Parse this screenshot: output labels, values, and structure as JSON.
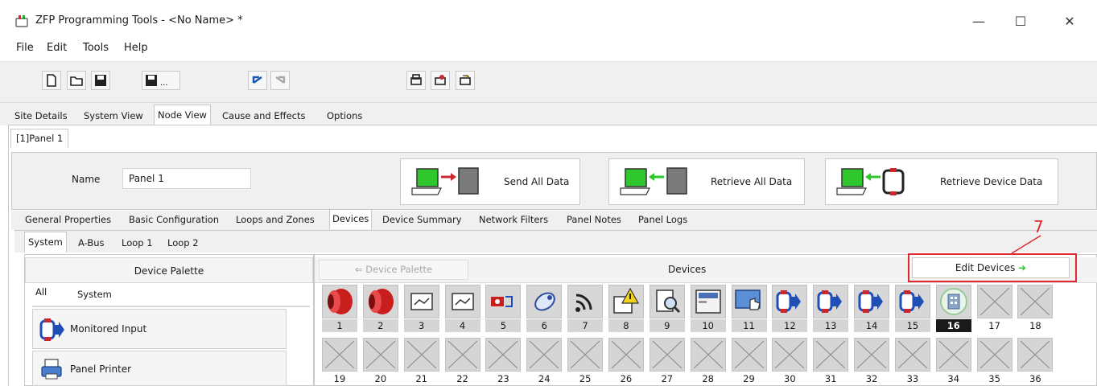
{
  "window": {
    "title": "ZFP Programming Tools - <No Name> *",
    "controls": {
      "minimize": "—",
      "maximize": "☐",
      "close": "✕"
    }
  },
  "menu": [
    "File",
    "Edit",
    "Tools",
    "Help"
  ],
  "toolbar_icons": [
    "new-file-icon",
    "open-folder-icon",
    "save-icon",
    "save-as-icon",
    "undo-icon",
    "redo-icon",
    "print-icon",
    "print-preview-icon",
    "print-setup-icon"
  ],
  "main_tabs": [
    "Site Details",
    "System View",
    "Node View",
    "Cause and Effects",
    "Options"
  ],
  "node_tab": "[1]Panel 1",
  "name_field": {
    "label": "Name",
    "value": "Panel 1"
  },
  "actions": {
    "send_all": "Send All Data",
    "retrieve_all": "Retrieve All Data",
    "retrieve_device": "Retrieve Device Data"
  },
  "property_tabs": [
    "General Properties",
    "Basic Configuration",
    "Loops and Zones",
    "Devices",
    "Device Summary",
    "Network Filters",
    "Panel Notes",
    "Panel Logs"
  ],
  "system_tabs": [
    "System",
    "A-Bus",
    "Loop 1",
    "Loop 2"
  ],
  "palette": {
    "header": "Device Palette",
    "subtabs": [
      "All",
      "System"
    ],
    "items": [
      "Monitored Input",
      "Panel Printer"
    ]
  },
  "devices": {
    "palette_button": "Device Palette",
    "title": "Devices",
    "edit_button": "Edit Devices",
    "callout": "7",
    "row1": [
      "1",
      "2",
      "3",
      "4",
      "5",
      "6",
      "7",
      "8",
      "9",
      "10",
      "11",
      "12",
      "13",
      "14",
      "15",
      "16",
      "17",
      "18"
    ],
    "row2": [
      "19",
      "20",
      "21",
      "22",
      "23",
      "24",
      "25",
      "26",
      "27",
      "28",
      "29",
      "30",
      "31",
      "32",
      "33",
      "34",
      "35",
      "36"
    ],
    "row1_icons": [
      "red-sounder-icon",
      "red-sounder-icon",
      "line-module-icon",
      "line-module-icon",
      "key-switch-icon",
      "beam-detector-icon",
      "wireless-icon",
      "warning-sign-icon",
      "document-search-icon",
      "panel-display-icon",
      "touch-screen-icon",
      "monitored-input-icon",
      "monitored-input-icon",
      "monitored-input-icon",
      "monitored-input-icon",
      "building-icon",
      "empty-slot-icon",
      "empty-slot-icon"
    ]
  }
}
